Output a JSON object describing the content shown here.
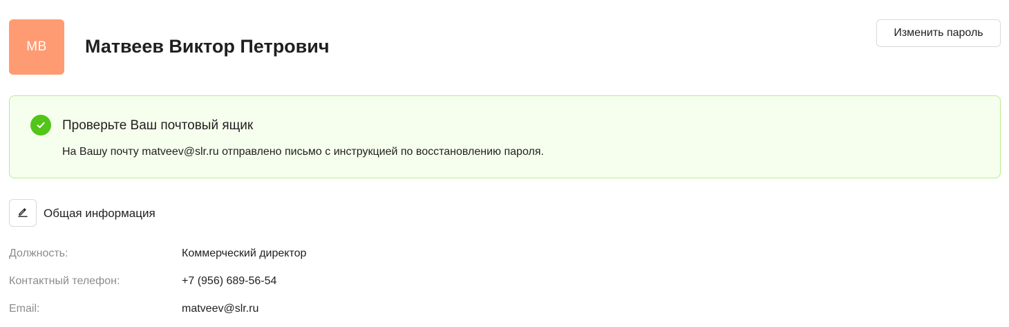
{
  "header": {
    "avatar_initials": "МВ",
    "avatar_color": "#ff9b73",
    "user_name": "Матвеев Виктор Петрович",
    "change_password_label": "Изменить пароль"
  },
  "alert": {
    "type": "success",
    "icon": "check-circle-icon",
    "accent_color": "#52c41a",
    "title": "Проверьте Ваш почтовый ящик",
    "description": "На Вашу почту matveev@slr.ru отправлено письмо с инструкцией по восстановлению пароля."
  },
  "general_info": {
    "edit_icon": "pencil-icon",
    "title": "Общая информация",
    "fields": [
      {
        "label": "Должность:",
        "value": "Коммерческий директор"
      },
      {
        "label": "Контактный телефон:",
        "value": "+7 (956) 689-56-54"
      },
      {
        "label": "Email:",
        "value": "matveev@slr.ru"
      }
    ]
  }
}
